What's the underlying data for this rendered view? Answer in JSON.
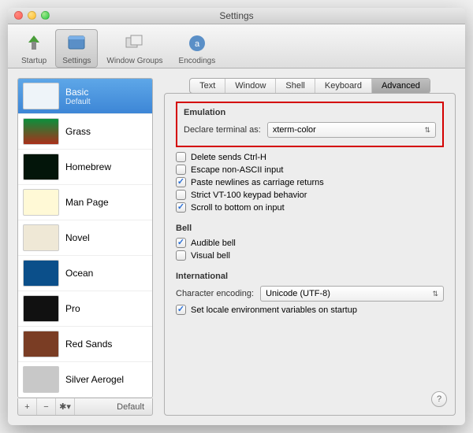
{
  "title": "Settings",
  "toolbar": [
    {
      "name": "startup",
      "label": "Startup"
    },
    {
      "name": "settings",
      "label": "Settings"
    },
    {
      "name": "window-groups",
      "label": "Window Groups"
    },
    {
      "name": "encodings",
      "label": "Encodings"
    }
  ],
  "toolbar_selected": "settings",
  "profiles": [
    {
      "name": "Basic",
      "sub": "Default",
      "thumb_bg": "#eef4f9"
    },
    {
      "name": "Grass",
      "thumb_bg": "linear-gradient(#0a8f3c,#a92f1a)"
    },
    {
      "name": "Homebrew",
      "thumb_bg": "#03150a"
    },
    {
      "name": "Man Page",
      "thumb_bg": "#fff9d6"
    },
    {
      "name": "Novel",
      "thumb_bg": "#efe8d6"
    },
    {
      "name": "Ocean",
      "thumb_bg": "#0b4f8a"
    },
    {
      "name": "Pro",
      "thumb_bg": "#111111"
    },
    {
      "name": "Red Sands",
      "thumb_bg": "#7a3d24"
    },
    {
      "name": "Silver Aerogel",
      "thumb_bg": "#c8c8c8"
    }
  ],
  "profile_selected": "Basic",
  "sidebar_buttons": {
    "add": "+",
    "remove": "−",
    "gear": "✱▾",
    "default_label": "Default"
  },
  "tabs": [
    "Text",
    "Window",
    "Shell",
    "Keyboard",
    "Advanced"
  ],
  "tab_selected": "Advanced",
  "emulation": {
    "title": "Emulation",
    "declare_label": "Declare terminal as:",
    "declare_value": "xterm-color",
    "opts": [
      {
        "label": "Delete sends Ctrl-H",
        "checked": false
      },
      {
        "label": "Escape non-ASCII input",
        "checked": false
      },
      {
        "label": "Paste newlines as carriage returns",
        "checked": true
      },
      {
        "label": "Strict VT-100 keypad behavior",
        "checked": false
      },
      {
        "label": "Scroll to bottom on input",
        "checked": true
      }
    ]
  },
  "bell": {
    "title": "Bell",
    "opts": [
      {
        "label": "Audible bell",
        "checked": true
      },
      {
        "label": "Visual bell",
        "checked": false
      }
    ]
  },
  "intl": {
    "title": "International",
    "encoding_label": "Character encoding:",
    "encoding_value": "Unicode (UTF-8)",
    "locale": {
      "label": "Set locale environment variables on startup",
      "checked": true
    }
  },
  "help": "?"
}
